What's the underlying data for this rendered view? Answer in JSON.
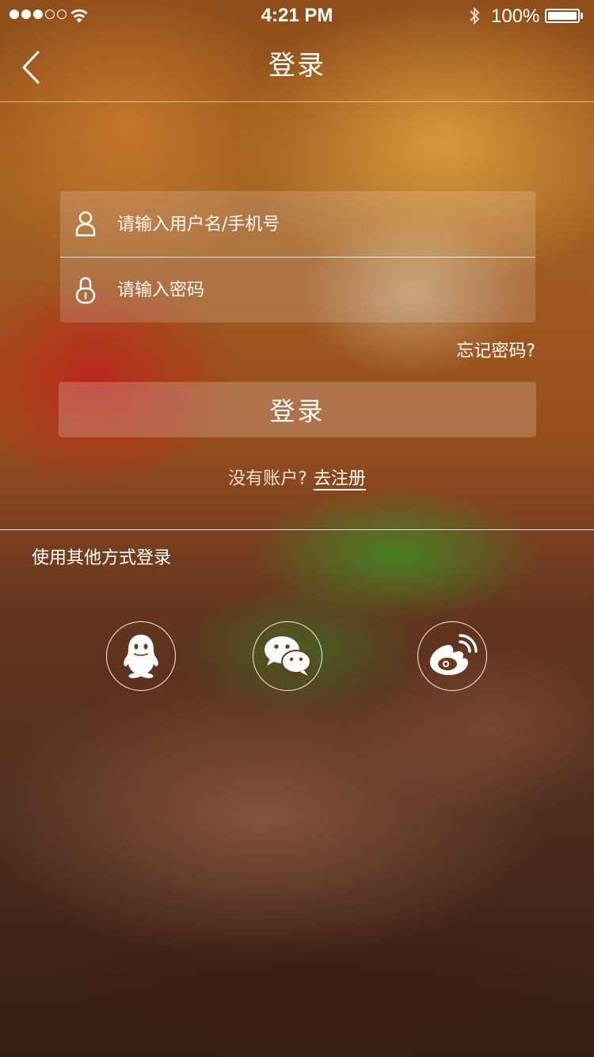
{
  "status_bar": {
    "time": "4:21 PM",
    "battery_percent": "100%",
    "signal_bars_full": 3,
    "signal_bars_total": 5,
    "battery_level": 1.0
  },
  "nav": {
    "title": "登录",
    "back_icon": "chevron-left-icon"
  },
  "form": {
    "username_placeholder": "请输入用户名/手机号",
    "password_placeholder": "请输入密码",
    "username_icon": "user-icon",
    "password_icon": "lock-icon"
  },
  "forgot_password": "忘记密码?",
  "login_button": "登录",
  "register": {
    "prompt": "没有账户?",
    "link": "去注册"
  },
  "other_login": {
    "title": "使用其他方式登录",
    "methods": [
      {
        "name": "QQ",
        "icon": "qq-icon"
      },
      {
        "name": "WeChat",
        "icon": "wechat-icon"
      },
      {
        "name": "Weibo",
        "icon": "weibo-icon"
      }
    ]
  },
  "colors": {
    "text": "#ffffff",
    "nav_divider": "#f5c86e"
  }
}
